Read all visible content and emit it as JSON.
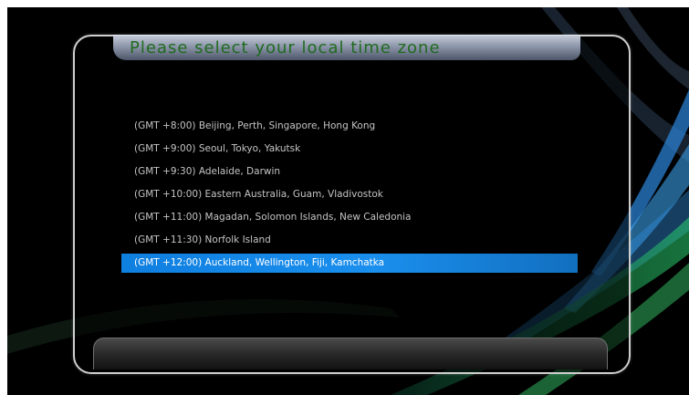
{
  "dialog": {
    "title": "Please select your local time zone"
  },
  "timezones": [
    {
      "label": "(GMT +8:00) Beijing, Perth, Singapore, Hong Kong",
      "selected": false
    },
    {
      "label": "(GMT +9:00) Seoul, Tokyo, Yakutsk",
      "selected": false
    },
    {
      "label": "(GMT +9:30) Adelaide, Darwin",
      "selected": false
    },
    {
      "label": "(GMT +10:00) Eastern Australia, Guam, Vladivostok",
      "selected": false
    },
    {
      "label": "(GMT +11:00) Magadan, Solomon Islands, New Caledonia",
      "selected": false
    },
    {
      "label": "(GMT +11:30) Norfolk Island",
      "selected": false
    },
    {
      "label": "(GMT +12:00) Auckland, Wellington, Fiji, Kamchatka",
      "selected": true
    }
  ],
  "colors": {
    "background": "#000000",
    "title_text": "#1f6b1f",
    "selection_highlight": "#1a8fee",
    "item_text": "#c4c4c4"
  }
}
